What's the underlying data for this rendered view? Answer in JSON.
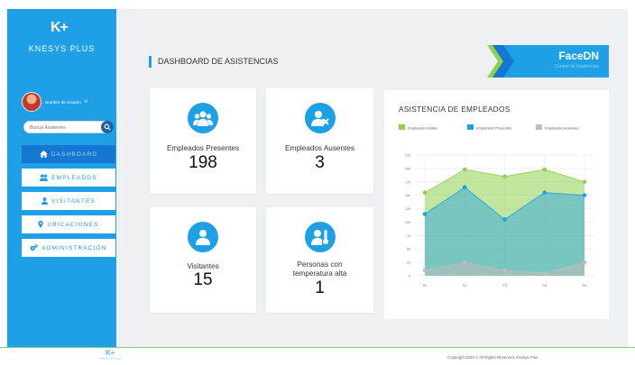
{
  "sidebar": {
    "logo_mark": "K+",
    "logo_text": "KNESYS PLUS",
    "user_name": "Nombre de Usuario",
    "user_chevron": "v",
    "search_placeholder": "Buscar Asistentes",
    "nav": [
      {
        "label": "DASHBOARD",
        "icon": "home-icon"
      },
      {
        "label": "EMPLEADOS",
        "icon": "users-icon"
      },
      {
        "label": "VISITANTES",
        "icon": "user-icon"
      },
      {
        "label": "UBICACIONES",
        "icon": "location-pin-icon"
      },
      {
        "label": "ADMINISTRACIÓN",
        "icon": "gears-icon"
      }
    ]
  },
  "main": {
    "page_title": "DASHBOARD DE ASISTENCIAS",
    "brand_title": "FaceDN",
    "brand_subtitle": "Control de Asistencias"
  },
  "cards": [
    {
      "label": "Empleados Presentes",
      "value": "198",
      "icon": "group-icon"
    },
    {
      "label": "Empleados Ausentes",
      "value": "3",
      "icon": "user-x-icon"
    },
    {
      "label": "Visitantes",
      "value": "15",
      "icon": "visitor-icon"
    },
    {
      "label": "Personas con temperatura alta",
      "value": "1",
      "icon": "thermometer-user-icon"
    }
  ],
  "chart_data": {
    "type": "area",
    "title": "ASISTENCIA DE EMPLEADOS",
    "categories": [
      "S1",
      "S2",
      "S3",
      "S4",
      "S5"
    ],
    "series": [
      {
        "name": "Empleados totales",
        "values": [
          155,
          198,
          185,
          198,
          175
        ],
        "color": "#8fd14f"
      },
      {
        "name": "Empleados Presentes",
        "values": [
          115,
          165,
          105,
          155,
          150
        ],
        "color": "#1ea0e6"
      },
      {
        "name": "Empleados Ausentes",
        "values": [
          10,
          25,
          10,
          5,
          25
        ],
        "color": "#bdbdbd"
      }
    ],
    "y_ticks": [
      "0",
      "25",
      "50",
      "75",
      "100",
      "125",
      "150",
      "175",
      "200",
      "225"
    ],
    "ylim": [
      0,
      225
    ],
    "grid": true,
    "legend": "top"
  },
  "footer": {
    "logo_mark": "K+",
    "logo_sub": "KNESYS PLUS",
    "copyright": "Copyright 2020 © All Rights Reserved. Knesys Plus"
  }
}
